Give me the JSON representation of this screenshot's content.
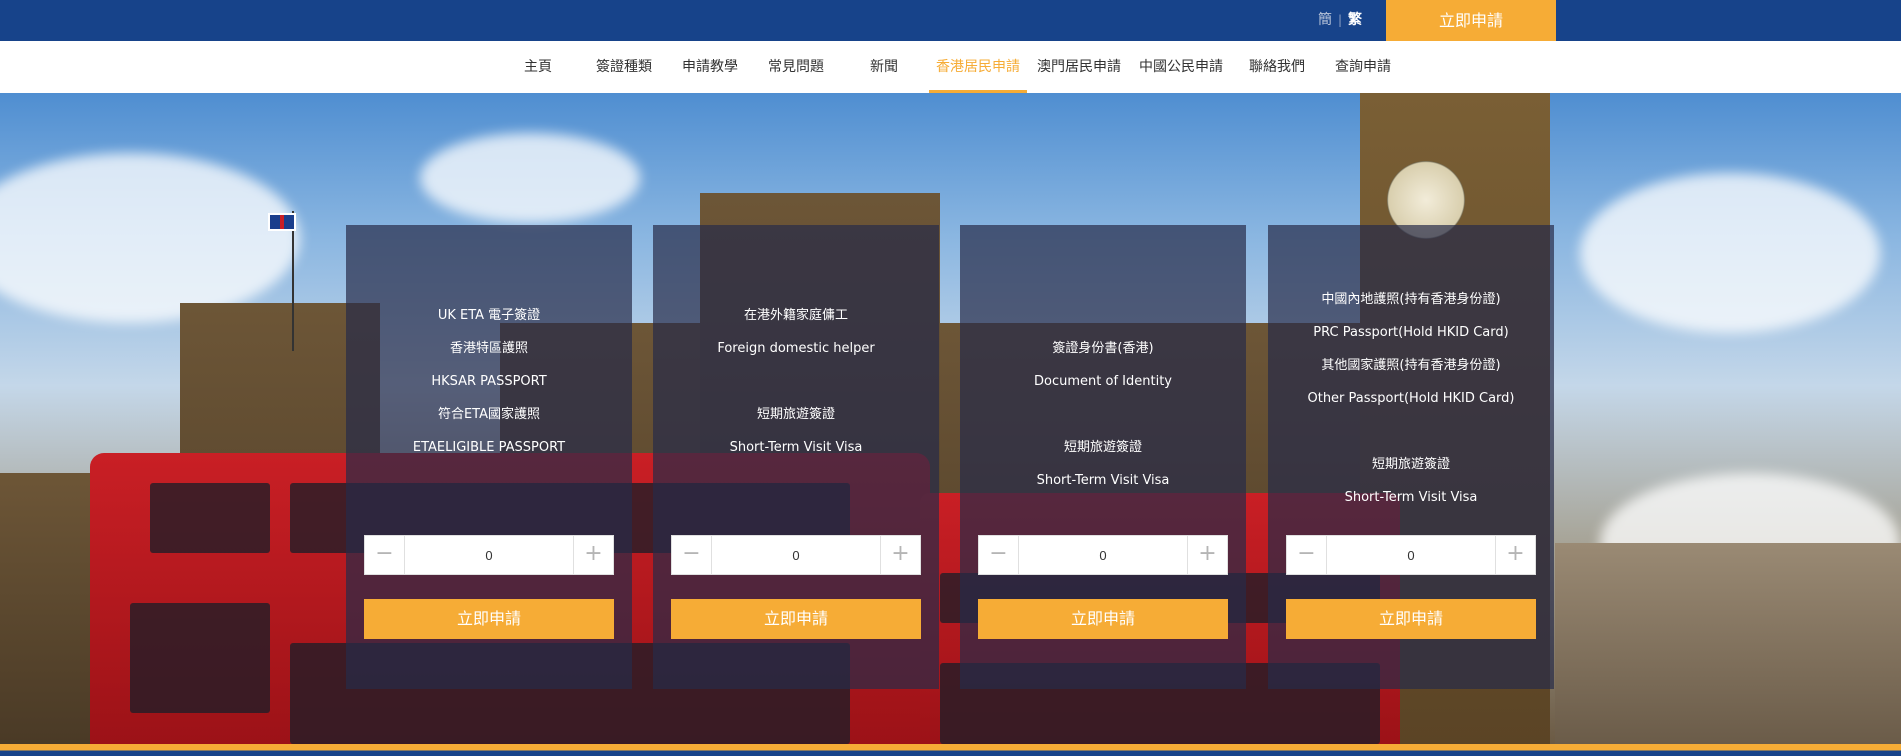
{
  "header": {
    "lang_simplified": "簡",
    "lang_separator": "|",
    "lang_traditional": "繁",
    "apply_button": "立即申請"
  },
  "nav": {
    "items": [
      "主頁",
      "簽證種類",
      "申請教學",
      "常見問題",
      "新聞",
      "香港居民申請",
      "澳門居民申請",
      "中國公民申請",
      "聯絡我們",
      "查詢申請"
    ],
    "active": "香港居民申請"
  },
  "cards": [
    {
      "lines": [
        "UK ETA 電子簽證",
        "香港特區護照",
        "HKSAR PASSPORT",
        "符合ETA國家護照",
        "ETAELIGIBLE PASSPORT"
      ],
      "quantity": "0",
      "apply_label": "立即申請"
    },
    {
      "lines": [
        "在港外籍家庭傭工",
        "Foreign domestic helper",
        "",
        "短期旅遊簽證",
        "Short-Term Visit Visa"
      ],
      "quantity": "0",
      "apply_label": "立即申請"
    },
    {
      "lines": [
        "簽證身份書(香港)",
        "Document of Identity",
        "",
        "短期旅遊簽證",
        "Short-Term Visit Visa"
      ],
      "quantity": "0",
      "apply_label": "立即申請"
    },
    {
      "lines": [
        "中國內地護照(持有香港身份證)",
        "PRC Passport(Hold HKID Card)",
        "其他國家護照(持有香港身份證)",
        "Other Passport(Hold HKID Card)",
        "",
        "短期旅遊簽證",
        "Short-Term Visit Visa"
      ],
      "quantity": "0",
      "apply_label": "立即申請"
    }
  ],
  "stepper": {
    "minus": "−",
    "plus": "+"
  },
  "colors": {
    "primary": "#17438a",
    "accent": "#f6ac36",
    "card_overlay": "#262b48"
  }
}
